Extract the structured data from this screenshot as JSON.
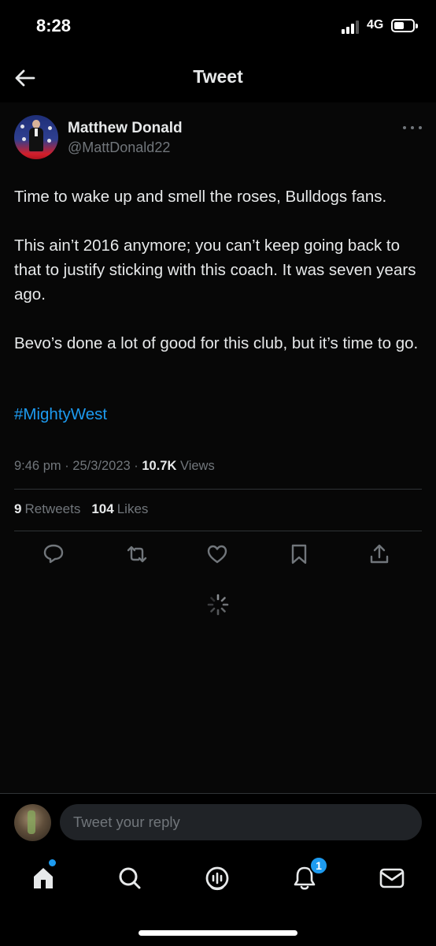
{
  "status_bar": {
    "time": "8:28",
    "network": "4G"
  },
  "header": {
    "title": "Tweet"
  },
  "tweet": {
    "author_name": "Matthew Donald",
    "handle": "@MattDonald22",
    "paragraphs": [
      "Time to wake up and smell the roses, Bulldogs fans.",
      "This ain’t 2016 anymore; you can’t keep going back to that to justify sticking with this coach. It was seven years ago.",
      "Bevo’s done a lot of good for this club, but it’s time to go."
    ],
    "hashtag": "#MightyWest",
    "time": "9:46 pm",
    "date": "25/3/2023",
    "separator": " · ",
    "views_count": "10.7K",
    "views_label": "Views",
    "retweets_count": "9",
    "retweets_label": "Retweets",
    "likes_count": "104",
    "likes_label": "Likes"
  },
  "actions": [
    "reply-icon",
    "retweet-icon",
    "like-icon",
    "bookmark-icon",
    "share-icon"
  ],
  "reply": {
    "placeholder": "Tweet your reply"
  },
  "tabbar": {
    "items": [
      "home-icon",
      "search-icon",
      "spaces-icon",
      "notifications-icon",
      "messages-icon"
    ],
    "notifications_badge": "1"
  },
  "colors": {
    "accent": "#1d9bf0",
    "background": "#000000",
    "text": "#e7e9ea",
    "muted": "#71767b"
  }
}
